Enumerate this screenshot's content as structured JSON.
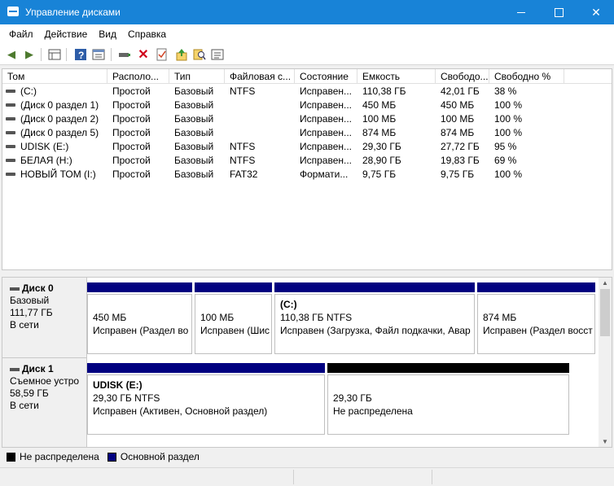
{
  "window": {
    "title": "Управление дисками"
  },
  "menu": [
    "Файл",
    "Действие",
    "Вид",
    "Справка"
  ],
  "toolbar_icons": [
    "back-arrow-icon",
    "forward-arrow-icon",
    "properties-grid-icon",
    "help-icon",
    "console-icon",
    "connect-disk-icon",
    "delete-icon",
    "check-icon",
    "import-icon",
    "search-disk-icon",
    "details-icon"
  ],
  "volumes": {
    "columns": [
      "Том",
      "Располо...",
      "Тип",
      "Файловая с...",
      "Состояние",
      "Емкость",
      "Свободо...",
      "Свободно %"
    ],
    "rows": [
      [
        "(C:)",
        "Простой",
        "Базовый",
        "NTFS",
        "Исправен...",
        "110,38 ГБ",
        "42,01 ГБ",
        "38 %"
      ],
      [
        "(Диск 0 раздел 1)",
        "Простой",
        "Базовый",
        "",
        "Исправен...",
        "450 МБ",
        "450 МБ",
        "100 %"
      ],
      [
        "(Диск 0 раздел 2)",
        "Простой",
        "Базовый",
        "",
        "Исправен...",
        "100 МБ",
        "100 МБ",
        "100 %"
      ],
      [
        "(Диск 0 раздел 5)",
        "Простой",
        "Базовый",
        "",
        "Исправен...",
        "874 МБ",
        "874 МБ",
        "100 %"
      ],
      [
        "UDISK (E:)",
        "Простой",
        "Базовый",
        "NTFS",
        "Исправен...",
        "29,30 ГБ",
        "27,72 ГБ",
        "95 %"
      ],
      [
        "БЕЛАЯ (H:)",
        "Простой",
        "Базовый",
        "NTFS",
        "Исправен...",
        "28,90 ГБ",
        "19,83 ГБ",
        "69 %"
      ],
      [
        "НОВЫЙ ТОМ (I:)",
        "Простой",
        "Базовый",
        "FAT32",
        "Формати...",
        "9,75 ГБ",
        "9,75 ГБ",
        "100 %"
      ]
    ]
  },
  "disks": [
    {
      "name": "Диск 0",
      "type": "Базовый",
      "size": "111,77 ГБ",
      "status": "В сети",
      "partitions": [
        {
          "name": "",
          "size": "450 МБ",
          "state": "Исправен (Раздел во",
          "kind": "primary"
        },
        {
          "name": "",
          "size": "100 МБ",
          "state": "Исправен (Шис",
          "kind": "primary"
        },
        {
          "name": "(C:)",
          "size": "110,38 ГБ NTFS",
          "state": "Исправен (Загрузка, Файл подкачки, Авар",
          "kind": "primary"
        },
        {
          "name": "",
          "size": "874 МБ",
          "state": "Исправен (Раздел восст",
          "kind": "primary"
        }
      ]
    },
    {
      "name": "Диск 1",
      "type": "Съемное устро",
      "size": "58,59 ГБ",
      "status": "В сети",
      "partitions": [
        {
          "name": "UDISK  (E:)",
          "size": "29,30 ГБ NTFS",
          "state": "Исправен (Активен, Основной раздел)",
          "kind": "primary"
        },
        {
          "name": "",
          "size": "29,30 ГБ",
          "state": "Не распределена",
          "kind": "unallocated"
        }
      ]
    }
  ],
  "legend": [
    {
      "label": "Не распределена",
      "color": "#000000"
    },
    {
      "label": "Основной раздел",
      "color": "#000080"
    }
  ],
  "colors": {
    "primary": "#000080",
    "unallocated": "#000000",
    "titlebar": "#1883d7"
  }
}
